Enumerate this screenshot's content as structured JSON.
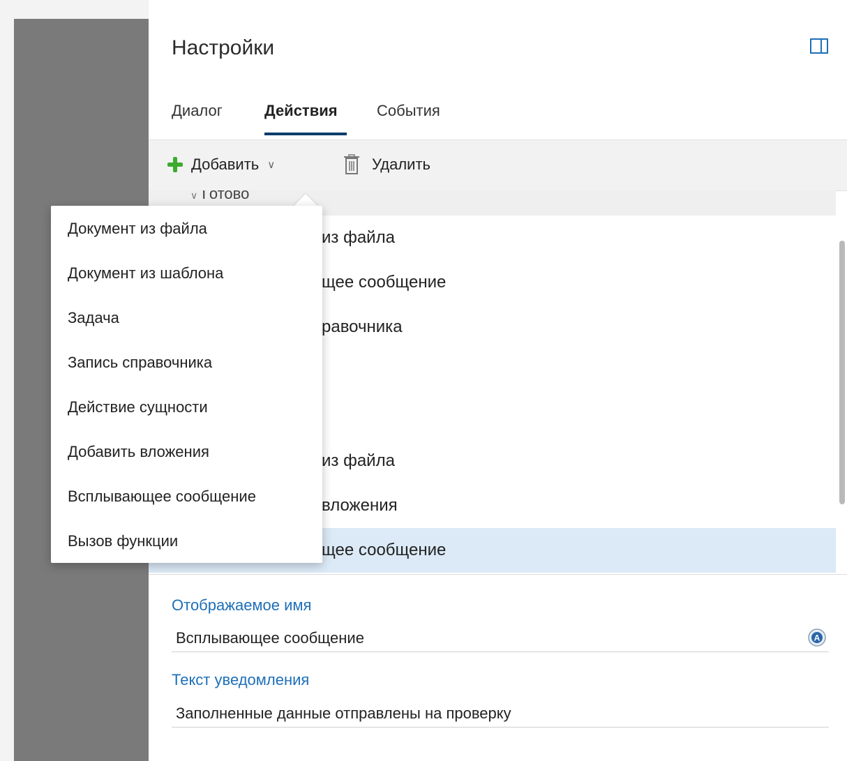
{
  "panel": {
    "title": "Настройки",
    "tabs": [
      {
        "label": "Диалог",
        "active": false
      },
      {
        "label": "Действия",
        "active": true
      },
      {
        "label": "События",
        "active": false
      }
    ]
  },
  "toolbar": {
    "add_label": "Добавить",
    "delete_label": "Удалить"
  },
  "list": {
    "group_label": "Готово",
    "items": [
      "из файла",
      "щее сообщение",
      "равочника",
      "из файла",
      "вложения",
      "щее сообщение"
    ],
    "selected_index": 5
  },
  "dropdown": {
    "items": [
      "Документ из файла",
      "Документ из шаблона",
      "Задача",
      "Запись справочника",
      "Действие сущности",
      "Добавить вложения",
      "Всплывающее сообщение",
      "Вызов функции"
    ]
  },
  "fields": {
    "display_name_label": "Отображаемое имя",
    "display_name_value": "Всплывающее сообщение",
    "notification_label": "Текст уведомления",
    "notification_value": "Заполненные данные отправлены на проверку"
  },
  "icons": {
    "add": "plus-icon",
    "delete": "trash-icon",
    "dock": "dock-panel-icon",
    "localize": "localize-icon"
  },
  "colors": {
    "accent_blue": "#1e6fb8",
    "tab_underline": "#0b3d6b",
    "plus_green": "#3dab2f",
    "selected_row": "#dceaf7"
  }
}
